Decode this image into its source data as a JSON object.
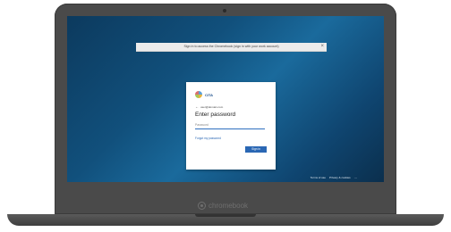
{
  "dialog": {
    "title": "Sign in to access the Chromebook (sign in with your work account)",
    "close_glyph": "×"
  },
  "card": {
    "logo_text": "CITA",
    "account_back": "←",
    "account_email": "user@domain.com",
    "title": "Enter password",
    "password_placeholder": "Password",
    "forgot_link": "Forgot my password",
    "signin_button": "Sign in"
  },
  "footer": {
    "terms": "Terms of use",
    "privacy": "Privacy & cookies",
    "more": "..."
  },
  "device": {
    "brand_text": "chromebook"
  }
}
